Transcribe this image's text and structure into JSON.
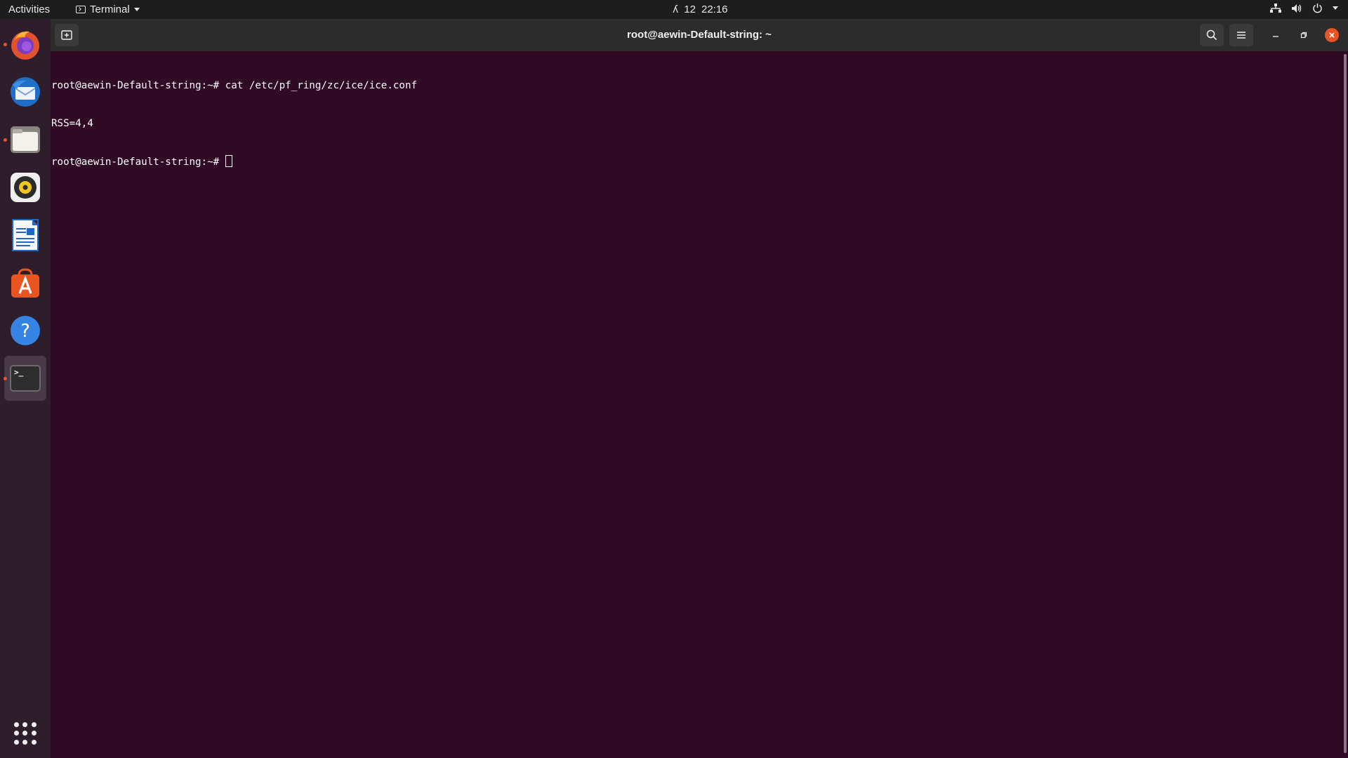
{
  "topbar": {
    "activities_label": "Activities",
    "app_menu_label": "Terminal",
    "clock_date": "12",
    "clock_time": "22:16",
    "tray_icons": [
      "network-icon",
      "volume-icon",
      "power-icon",
      "chevron-down-icon"
    ]
  },
  "dock": {
    "items": [
      {
        "name": "firefox",
        "running": true
      },
      {
        "name": "thunderbird",
        "running": false
      },
      {
        "name": "files",
        "running": true
      },
      {
        "name": "rhythmbox",
        "running": false
      },
      {
        "name": "libreoffice-writer",
        "running": false
      },
      {
        "name": "ubuntu-software",
        "running": false
      },
      {
        "name": "help",
        "running": false
      },
      {
        "name": "terminal",
        "running": true,
        "active": true
      }
    ],
    "terminal_glyph": ">_"
  },
  "window": {
    "title": "root@aewin-Default-string: ~"
  },
  "terminal": {
    "line1": "root@aewin-Default-string:~# cat /etc/pf_ring/zc/ice/ice.conf",
    "line2": "RSS=4,4",
    "line3": "root@aewin-Default-string:~# "
  },
  "colors": {
    "terminal_bg": "#300a24",
    "accent": "#e95420",
    "dock_bg": "#2e1d2b",
    "headerbar_bg": "#2c2c2c"
  }
}
